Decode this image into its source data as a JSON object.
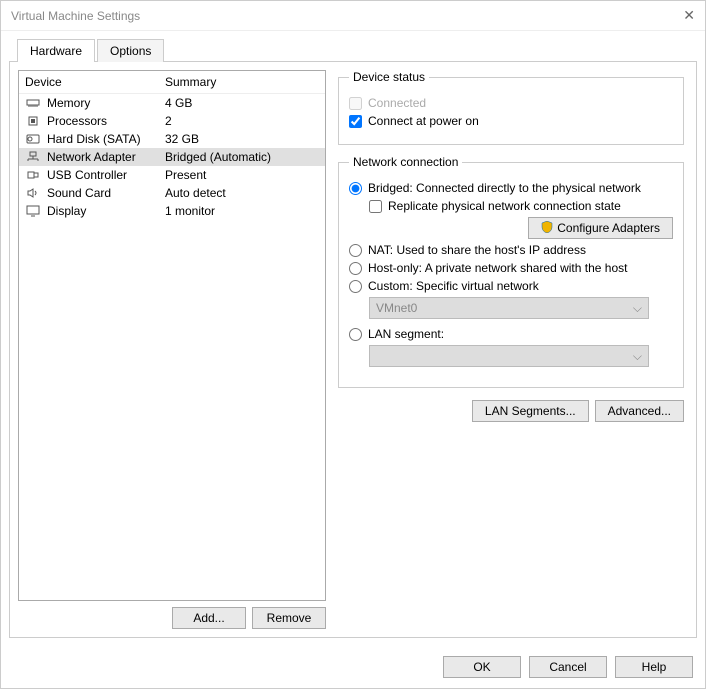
{
  "title": "Virtual Machine Settings",
  "tabs": {
    "hardware": "Hardware",
    "options": "Options"
  },
  "headers": {
    "device": "Device",
    "summary": "Summary"
  },
  "devices": [
    {
      "icon": "memory",
      "name": "Memory",
      "summary": "4 GB"
    },
    {
      "icon": "processors",
      "name": "Processors",
      "summary": "2"
    },
    {
      "icon": "harddisk",
      "name": "Hard Disk (SATA)",
      "summary": "32 GB"
    },
    {
      "icon": "network",
      "name": "Network Adapter",
      "summary": "Bridged (Automatic)"
    },
    {
      "icon": "usb",
      "name": "USB Controller",
      "summary": "Present"
    },
    {
      "icon": "sound",
      "name": "Sound Card",
      "summary": "Auto detect"
    },
    {
      "icon": "display",
      "name": "Display",
      "summary": "1 monitor"
    }
  ],
  "buttons": {
    "add": "Add...",
    "remove": "Remove",
    "lanseg": "LAN Segments...",
    "advanced": "Advanced...",
    "configure": "Configure Adapters",
    "ok": "OK",
    "cancel": "Cancel",
    "help": "Help"
  },
  "deviceStatus": {
    "legend": "Device status",
    "connected": "Connected",
    "poweron": "Connect at power on"
  },
  "netconn": {
    "legend": "Network connection",
    "bridged": "Bridged: Connected directly to the physical network",
    "replicate": "Replicate physical network connection state",
    "nat": "NAT: Used to share the host's IP address",
    "hostonly": "Host-only: A private network shared with the host",
    "custom": "Custom: Specific virtual network",
    "vmnet": "VMnet0",
    "lansegment": "LAN segment:"
  }
}
